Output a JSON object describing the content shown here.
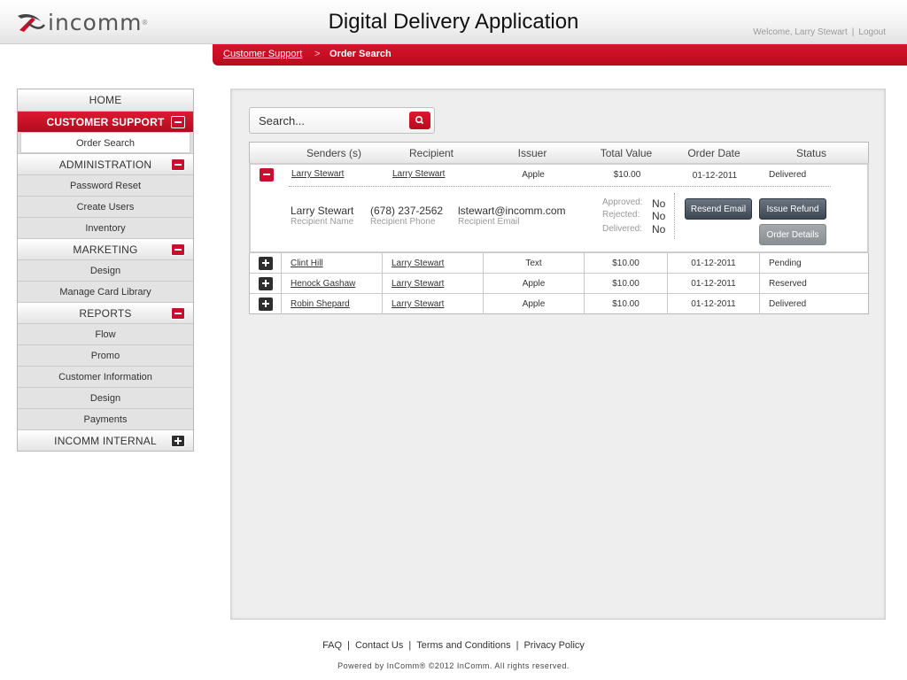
{
  "header": {
    "logo_text": "incomm",
    "logo_reg": "®",
    "title": "Digital Delivery Application",
    "welcome": "Welcome, Larry Stewart",
    "logout": "Logout"
  },
  "breadcrumb": {
    "parent": "Customer Support",
    "separator": ">",
    "current": "Order Search"
  },
  "sidebar": {
    "home": "HOME",
    "customer_support": "CUSTOMER SUPPORT",
    "order_search": "Order Search",
    "administration": "ADMINISTRATION",
    "password_reset": "Password Reset",
    "create_users": "Create Users",
    "inventory": "Inventory",
    "marketing": "MARKETING",
    "marketing_design": "Design",
    "manage_card_library": "Manage Card Library",
    "reports": "REPORTS",
    "flow": "Flow",
    "promo": "Promo",
    "customer_information": "Customer Information",
    "reports_design": "Design",
    "payments": "Payments",
    "incomm_internal": "INCOMM INTERNAL"
  },
  "search": {
    "placeholder": "Search..."
  },
  "table": {
    "headers": {
      "senders": "Senders (s)",
      "recipient": "Recipient",
      "issuer": "Issuer",
      "total_value": "Total Value",
      "order_date": "Order Date",
      "status": "Status"
    },
    "expanded": {
      "sender": "Larry Stewart",
      "recipient": "Larry Stewart",
      "issuer": "Apple",
      "total": "$10.00",
      "date": "01-12-2011",
      "status": "Delivered",
      "recipient_name": "Larry Stewart",
      "recipient_name_label": "Recipient Name",
      "recipient_phone": "(678) 237-2562",
      "recipient_phone_label": "Recipient Phone",
      "recipient_email": "lstewart@incomm.com",
      "recipient_email_label": "Recipient Email",
      "approved_label": "Approved:",
      "approved": "No",
      "rejected_label": "Rejected:",
      "rejected": "No",
      "delivered_label": "Delivered:",
      "delivered": "No",
      "resend_email": "Resend Email",
      "issue_refund": "Issue Refund",
      "order_details": "Order Details"
    },
    "rows": [
      {
        "sender": "Clint Hill",
        "recipient": "Larry Stewart",
        "issuer": "Text",
        "total": "$10.00",
        "date": "01-12-2011",
        "status": "Pending"
      },
      {
        "sender": "Henock Gashaw",
        "recipient": "Larry Stewart",
        "issuer": "Apple",
        "total": "$10.00",
        "date": "01-12-2011",
        "status": "Reserved"
      },
      {
        "sender": "Robin Shepard",
        "recipient": "Larry Stewart",
        "issuer": "Apple",
        "total": "$10.00",
        "date": "01-12-2011",
        "status": "Delivered"
      }
    ]
  },
  "footer": {
    "faq": "FAQ",
    "contact": "Contact Us",
    "terms": "Terms and Conditions",
    "privacy": "Privacy Policy",
    "separator": "|",
    "copyright": "Powered by InComm® ©2012 InComm. All rights reserved."
  },
  "colors": {
    "brand_red": "#c8102e",
    "button_dark": "#4a5560"
  },
  "icons": {
    "search": "magnifier-icon",
    "expand": "plus-icon",
    "collapse": "minus-icon"
  }
}
